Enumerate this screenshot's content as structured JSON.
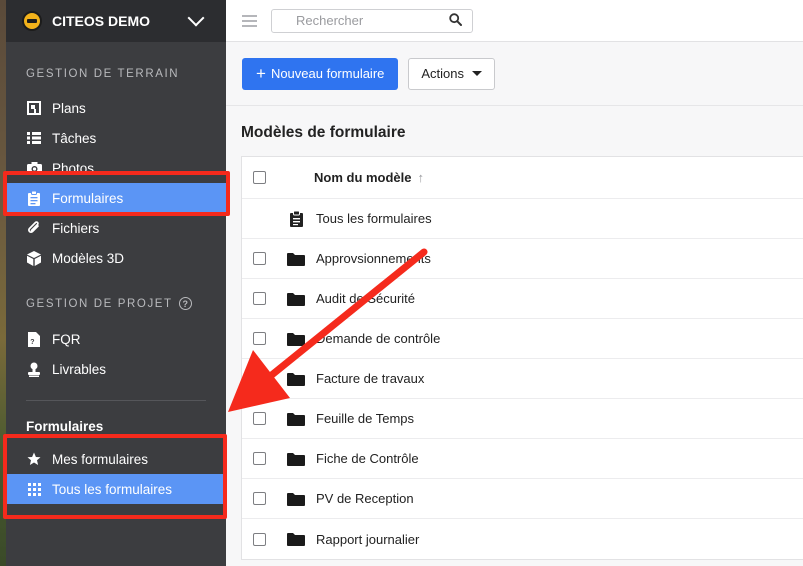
{
  "org": {
    "name": "CITEOS DEMO"
  },
  "sidebar": {
    "section_field": "GESTION DE TERRAIN",
    "field_items": [
      {
        "label": "Plans",
        "icon": "plans-icon"
      },
      {
        "label": "Tâches",
        "icon": "tasks-icon"
      },
      {
        "label": "Photos",
        "icon": "camera-icon"
      },
      {
        "label": "Formulaires",
        "icon": "clipboard-icon",
        "active": true
      },
      {
        "label": "Fichiers",
        "icon": "paperclip-icon"
      },
      {
        "label": "Modèles 3D",
        "icon": "cube-icon"
      }
    ],
    "section_project": "GESTION DE PROJET",
    "project_items": [
      {
        "label": "FQR",
        "icon": "document-icon"
      },
      {
        "label": "Livrables",
        "icon": "stamp-icon"
      }
    ],
    "forms_title": "Formulaires",
    "forms_items": [
      {
        "label": "Mes formulaires",
        "icon": "star-icon"
      },
      {
        "label": "Tous les formulaires",
        "icon": "grid-icon",
        "active": true
      }
    ]
  },
  "topbar": {
    "search_placeholder": "Rechercher"
  },
  "toolbar": {
    "new_label": "Nouveau formulaire",
    "actions_label": "Actions"
  },
  "main": {
    "title": "Modèles de formulaire",
    "column_name": "Nom du modèle",
    "all_forms": "Tous les formulaires",
    "folders": [
      "Approvsionnements",
      "Audit de Sécurité",
      "Demande de contrôle",
      "Facture de travaux",
      "Feuille de Temps",
      "Fiche de Contrôle",
      "PV de Reception",
      "Rapport journalier"
    ]
  },
  "colors": {
    "accent": "#2f74f0",
    "active_nav": "#5b95f5",
    "sidebar": "#3c3d40",
    "highlight": "#f52a1c"
  }
}
